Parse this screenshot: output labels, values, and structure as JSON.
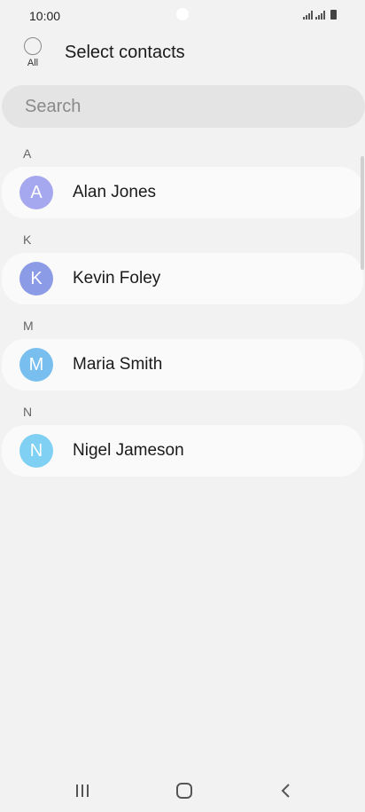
{
  "status": {
    "time": "10:00"
  },
  "header": {
    "all_label": "All",
    "title": "Select contacts"
  },
  "search": {
    "placeholder": "Search"
  },
  "sections": [
    {
      "letter": "A",
      "contact": {
        "initial": "A",
        "name": "Alan Jones",
        "color": "#a6a8ef"
      }
    },
    {
      "letter": "K",
      "contact": {
        "initial": "K",
        "name": "Kevin Foley",
        "color": "#8c9be6"
      }
    },
    {
      "letter": "M",
      "contact": {
        "initial": "M",
        "name": "Maria Smith",
        "color": "#78bff0"
      }
    },
    {
      "letter": "N",
      "contact": {
        "initial": "N",
        "name": "Nigel Jameson",
        "color": "#7fd0f2"
      }
    }
  ],
  "nav": {
    "recents_icon": "recents-icon",
    "home_icon": "home-icon",
    "back_icon": "back-icon"
  }
}
